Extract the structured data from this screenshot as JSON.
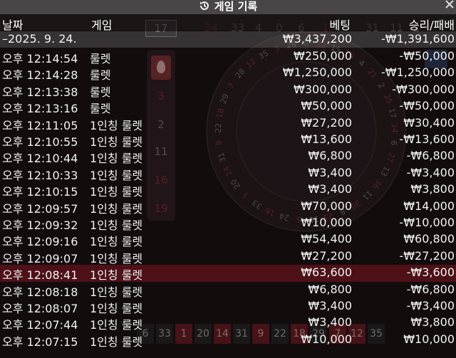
{
  "title": "게임 기록",
  "icons": {
    "history": "history-clock-icon",
    "close": "close-icon"
  },
  "columns": {
    "date": "날짜",
    "game": "게임",
    "bet": "베팅",
    "result": "승리/패배"
  },
  "date_group": {
    "label": "–2025. 9. 24.",
    "bet": "₩3,437,200",
    "result": "-₩1,391,600"
  },
  "rows": [
    {
      "time": "오후 12:14:54",
      "game": "룰렛",
      "bet": "₩250,000",
      "result": "-₩50,000"
    },
    {
      "time": "오후 12:14:28",
      "game": "룰렛",
      "bet": "₩1,250,000",
      "result": "-₩1,250,000"
    },
    {
      "time": "오후 12:13:38",
      "game": "룰렛",
      "bet": "₩300,000",
      "result": "-₩300,000"
    },
    {
      "time": "오후 12:13:16",
      "game": "룰렛",
      "bet": "₩50,000",
      "result": "-₩50,000"
    },
    {
      "time": "오후 12:11:05",
      "game": "1인칭 룰렛",
      "bet": "₩27,200",
      "result": "₩30,400"
    },
    {
      "time": "오후 12:10:55",
      "game": "1인칭 룰렛",
      "bet": "₩13,600",
      "result": "-₩13,600"
    },
    {
      "time": "오후 12:10:44",
      "game": "1인칭 룰렛",
      "bet": "₩6,800",
      "result": "-₩6,800"
    },
    {
      "time": "오후 12:10:33",
      "game": "1인칭 룰렛",
      "bet": "₩3,400",
      "result": "-₩3,400"
    },
    {
      "time": "오후 12:10:15",
      "game": "1인칭 룰렛",
      "bet": "₩3,400",
      "result": "₩3,800"
    },
    {
      "time": "오후 12:09:57",
      "game": "1인칭 룰렛",
      "bet": "₩70,000",
      "result": "₩14,000"
    },
    {
      "time": "오후 12:09:32",
      "game": "1인칭 룰렛",
      "bet": "₩10,000",
      "result": "-₩10,000"
    },
    {
      "time": "오후 12:09:16",
      "game": "1인칭 룰렛",
      "bet": "₩54,400",
      "result": "₩60,800"
    },
    {
      "time": "오후 12:09:07",
      "game": "1인칭 룰렛",
      "bet": "₩27,200",
      "result": "-₩27,200"
    },
    {
      "time": "오후 12:08:41",
      "game": "1인칭 룰렛",
      "bet": "₩63,600",
      "result": "-₩3,600"
    },
    {
      "time": "오후 12:08:18",
      "game": "1인칭 룰렛",
      "bet": "₩6,800",
      "result": "-₩6,800"
    },
    {
      "time": "오후 12:08:07",
      "game": "1인칭 룰렛",
      "bet": "₩3,400",
      "result": "-₩3,400"
    },
    {
      "time": "오후 12:07:44",
      "game": "1인칭 룰렛",
      "bet": "₩3,400",
      "result": "₩3,800"
    },
    {
      "time": "오후 12:07:15",
      "game": "1인칭 룰렛",
      "bet": "₩10,000",
      "result": "₩10,000"
    }
  ],
  "background": {
    "top_strip": [
      "17",
      "34",
      "33",
      "4",
      "0",
      "6",
      "1",
      "",
      "31",
      "11",
      "2"
    ],
    "side_column": [
      "3",
      "2",
      "11",
      "16",
      "19"
    ],
    "bottom_strip": [
      "6",
      "33",
      "1",
      "20",
      "14",
      "31",
      "9",
      "22",
      "18",
      "29",
      "7",
      "12",
      "35"
    ],
    "wheel_numbers": [
      "0",
      "32",
      "15",
      "19",
      "4",
      "21",
      "2",
      "25",
      "17",
      "34",
      "6",
      "27",
      "13",
      "36",
      "11",
      "30",
      "8",
      "23",
      "10",
      "5",
      "24",
      "16",
      "33",
      "1",
      "20",
      "14",
      "31",
      "9",
      "22",
      "18",
      "29",
      "7",
      "28",
      "12",
      "35",
      "3",
      "26"
    ],
    "colors": {
      "panel_bg": "#120c0d",
      "titlebar": "#4a4647",
      "highlight": "#961923",
      "date_row": "#969696"
    }
  }
}
